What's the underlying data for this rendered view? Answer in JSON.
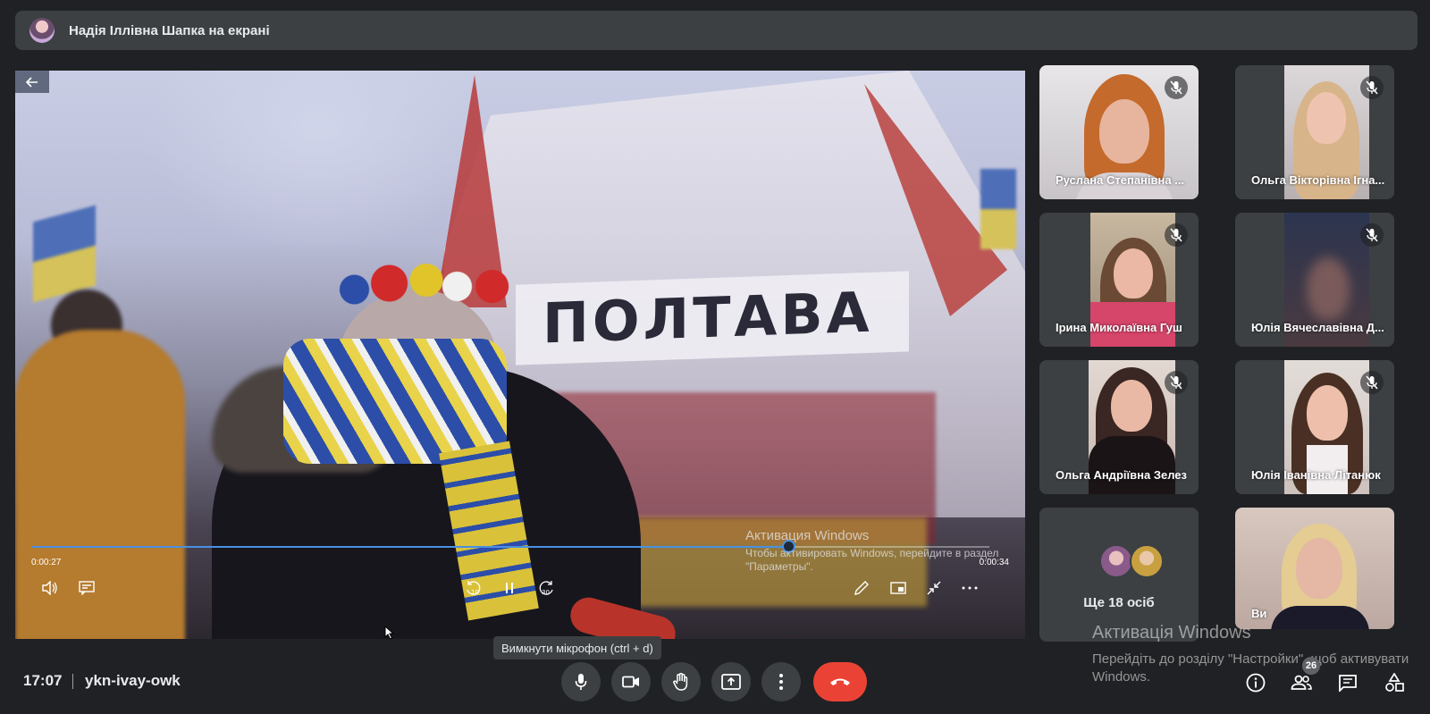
{
  "presenter": {
    "name": "Надія Іллівна Шапка на екрані"
  },
  "video": {
    "banner_text": "ПОЛТАВА",
    "current_time": "0:00:27",
    "total_time": "0:00:34",
    "progress": 0.79,
    "windows_activation_title": "Активация Windows",
    "windows_activation_text": "Чтобы активировать Windows, перейдите в раздел \"Параметры\"."
  },
  "participants": [
    {
      "name": "Руслана Степанівна ...",
      "muted": true
    },
    {
      "name": "Ольга Вікторівна Ігна...",
      "muted": true
    },
    {
      "name": "Ірина Миколаївна Гуш",
      "muted": true
    },
    {
      "name": "Юлія Вячеславівна Д...",
      "muted": true
    },
    {
      "name": "Ольга Андріївна Зелез",
      "muted": true
    },
    {
      "name": "Юлія Іванівна Літанюк",
      "muted": true
    }
  ],
  "more": {
    "label": "Ще 18 осіб"
  },
  "self": {
    "label": "Ви"
  },
  "activation": {
    "title": "Активація Windows",
    "text": "Перейдіть до розділу \"Настройки\", щоб активувати Windows."
  },
  "bottom": {
    "time": "17:07",
    "meeting_code": "ykn-ivay-owk",
    "tooltip": "Вимкнути мікрофон (ctrl + d)",
    "participants_count": "26"
  },
  "colors": {
    "background": "#202124",
    "tile": "#3c4043",
    "end_call": "#ea4335",
    "progress": "#4a90e2"
  }
}
